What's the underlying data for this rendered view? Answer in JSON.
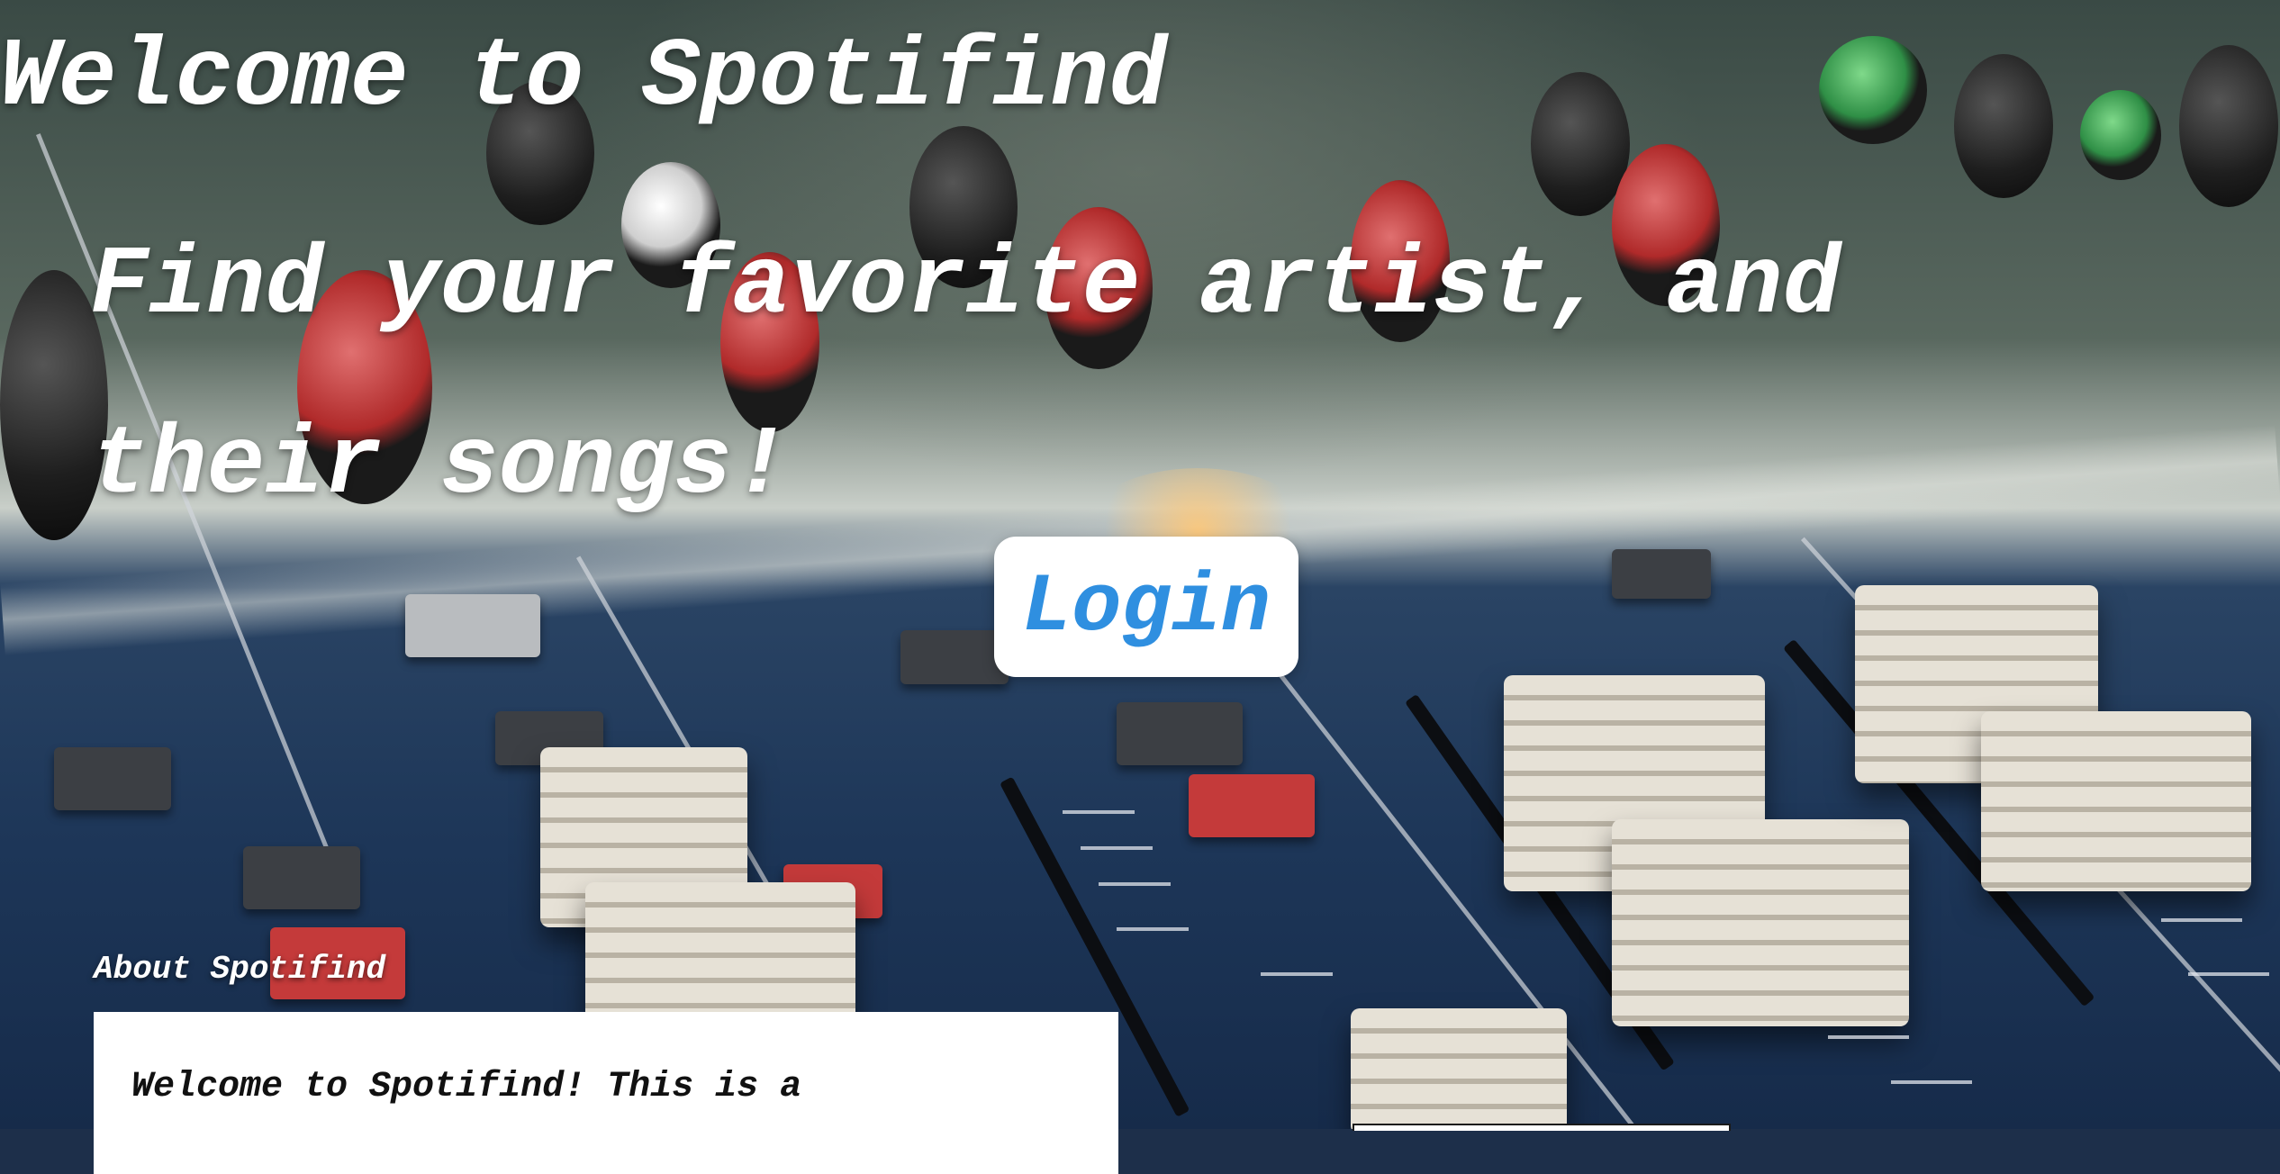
{
  "hero": {
    "title": "Welcome to Spotifind",
    "subtitle": "Find your favorite artist, and their songs!"
  },
  "login": {
    "label": "Login"
  },
  "about": {
    "heading": "About Spotifind",
    "body": "Welcome to Spotifind! This is a"
  },
  "colors": {
    "login_text": "#2f8fe0",
    "hero_text": "#ffffff",
    "card_background": "#ffffff"
  },
  "background": {
    "image": "blurred audio mixing console with knobs and faders"
  }
}
